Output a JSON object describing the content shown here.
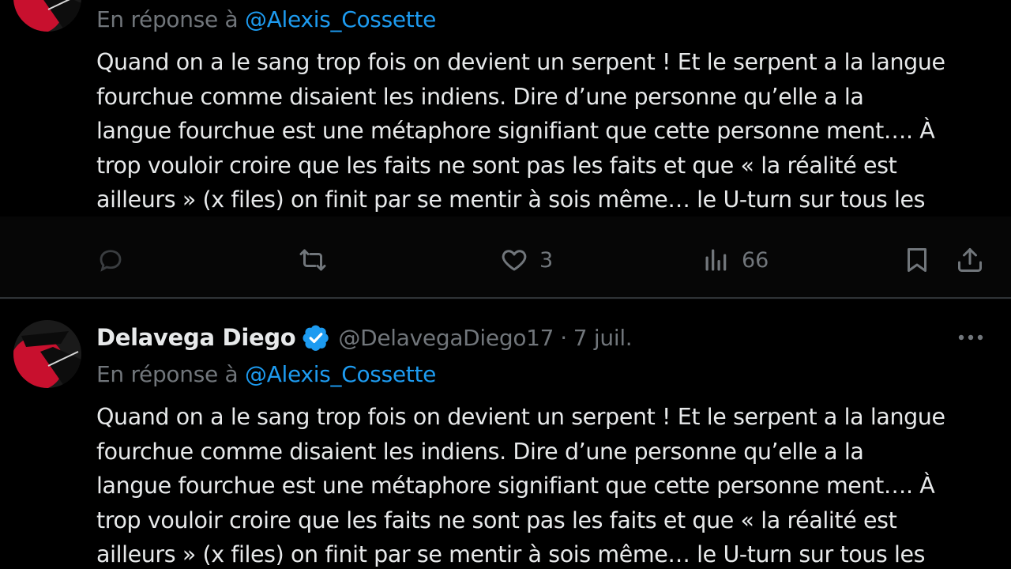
{
  "colors": {
    "background": "#000000",
    "text": "#e7e9ea",
    "muted": "#71767b",
    "accent": "#1d9bf0",
    "separator": "#2f3336"
  },
  "tweets": [
    {
      "reply_prefix": "En réponse à ",
      "reply_to": "@Alexis_Cossette",
      "lines": [
        "Quand on a le sang trop fois on devient un serpent ! Et le serpent a la langue",
        "fourchue comme disaient les indiens. Dire d’une personne qu’elle a la",
        "langue fourchue est une métaphore signifiant que cette personne ment…. À",
        "trop vouloir croire que les faits ne sont pas les faits et que « la réalité est",
        "ailleurs » (x files) on finit par se mentir à sois même… le U-turn sur tous les"
      ],
      "actions": {
        "reply_icon": "reply-icon",
        "retweet_icon": "retweet-icon",
        "like_icon": "heart-icon",
        "like_count": "3",
        "views_icon": "views-icon",
        "views_count": "66",
        "bookmark_icon": "bookmark-icon",
        "share_icon": "share-icon"
      }
    },
    {
      "display_name": "Delavega Diego",
      "verified_icon": "verified-badge-icon",
      "handle": "@DelavegaDiego17",
      "separator_dot": "·",
      "date": "7 juil.",
      "more_icon": "more-icon",
      "reply_prefix": "En réponse à ",
      "reply_to": "@Alexis_Cossette",
      "lines": [
        "Quand on a le sang trop fois on devient un serpent ! Et le serpent a la langue",
        "fourchue comme disaient les indiens. Dire d’une personne qu’elle a la",
        "langue fourchue est une métaphore signifiant que cette personne ment…. À",
        "trop vouloir croire que les faits ne sont pas les faits et que « la réalité est",
        "ailleurs » (x files) on finit par se mentir à sois même… le U-turn sur tous les"
      ]
    }
  ]
}
